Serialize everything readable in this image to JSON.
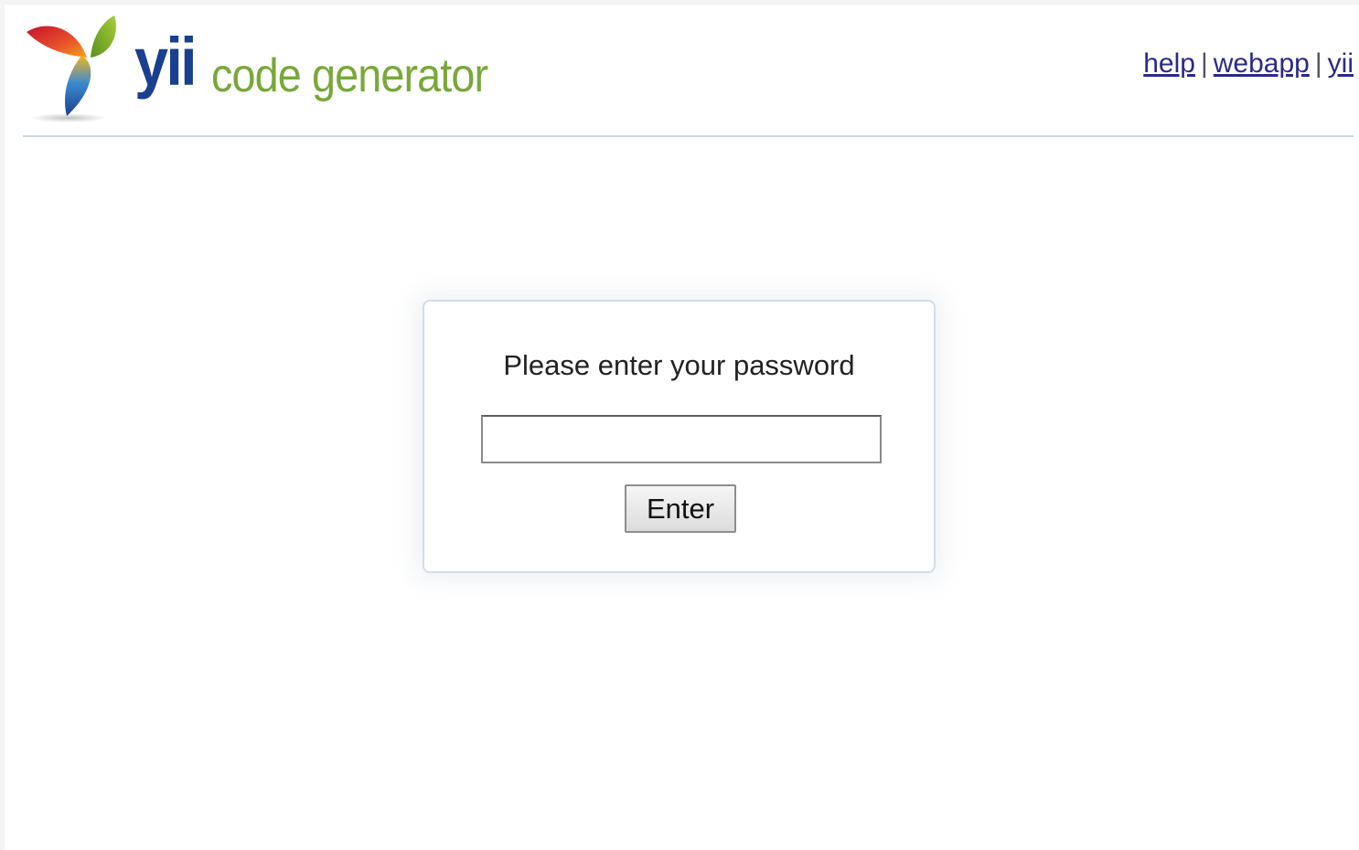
{
  "header": {
    "logo": {
      "brand": "yii",
      "product": "code generator",
      "brand_color": "#1a3f8f",
      "product_color": "#78a83a",
      "icon": "yii-leaf-logo-icon"
    },
    "links": [
      {
        "label": "help"
      },
      {
        "label": "webapp"
      },
      {
        "label": "yii"
      }
    ],
    "separator": "|"
  },
  "login": {
    "prompt": "Please enter your password",
    "password_value": "",
    "password_placeholder": "",
    "submit_label": "Enter"
  }
}
